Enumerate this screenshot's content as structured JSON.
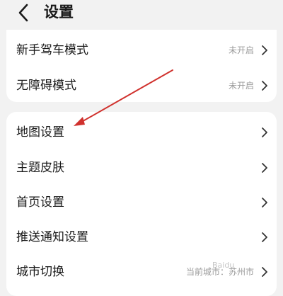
{
  "header": {
    "title": "设置",
    "back_icon": "chevron-left-icon"
  },
  "group1": {
    "items": [
      {
        "label": "新手驾车模式",
        "value": "未开启"
      },
      {
        "label": "无障碍模式",
        "value": "未开启"
      }
    ]
  },
  "group2": {
    "items": [
      {
        "label": "地图设置",
        "value": ""
      },
      {
        "label": "主题皮肤",
        "value": ""
      },
      {
        "label": "首页设置",
        "value": ""
      },
      {
        "label": "推送通知设置",
        "value": ""
      },
      {
        "label": "城市切换",
        "value": "当前城市：苏州市"
      }
    ]
  },
  "colors": {
    "background": "#f2f2f2",
    "card": "#ffffff",
    "annotation_arrow": "#d0312d"
  },
  "watermark": "Baidu"
}
